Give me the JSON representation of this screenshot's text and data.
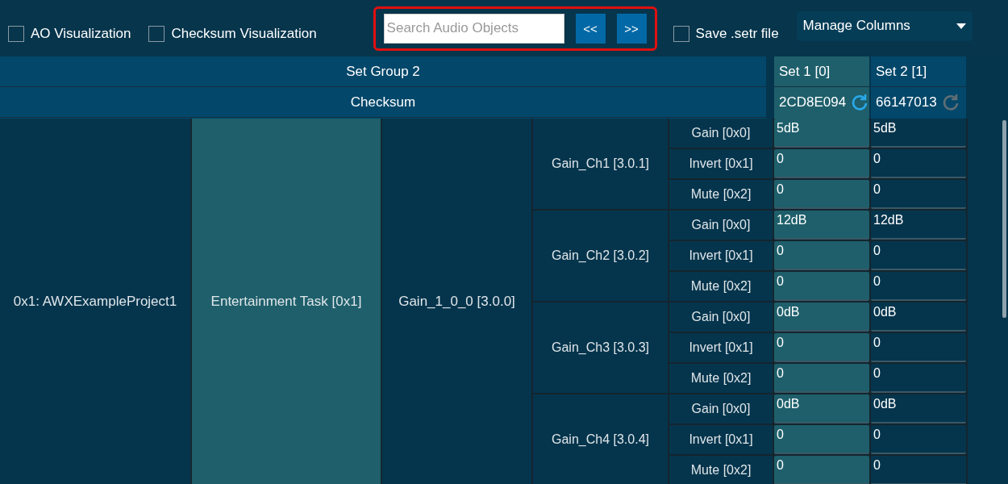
{
  "toolbar": {
    "checkboxes": [
      {
        "label": "AO Visualization",
        "checked": false
      },
      {
        "label": "Checksum Visualization",
        "checked": false
      }
    ],
    "search": {
      "placeholder": "Search Audio Objects",
      "highlighted": true,
      "buttons": [
        "<<",
        ">>"
      ]
    },
    "save_checkbox": {
      "label": "Save .setr file",
      "checked": false
    },
    "manage_columns": {
      "label": "Manage Columns"
    }
  },
  "header": {
    "group": "Set Group 2",
    "checksum_label": "Checksum",
    "sets": [
      {
        "name": "Set 1 [0]",
        "selected": true,
        "checksum": "2CD8E094",
        "refresh_enabled": true
      },
      {
        "name": "Set 2 [1]",
        "selected": false,
        "checksum": "66147013",
        "refresh_enabled": false
      }
    ]
  },
  "tree": {
    "project": "0x1: AWXExampleProject1",
    "task": "Entertainment Task [0x1]",
    "module": "Gain_1_0_0 [3.0.0]",
    "channels": [
      {
        "name": "Gain_Ch1 [3.0.1]",
        "params": [
          {
            "name": "Gain [0x0]",
            "values": [
              "5dB",
              "5dB"
            ]
          },
          {
            "name": "Invert [0x1]",
            "values": [
              "0",
              "0"
            ]
          },
          {
            "name": "Mute [0x2]",
            "values": [
              "0",
              "0"
            ]
          }
        ]
      },
      {
        "name": "Gain_Ch2 [3.0.2]",
        "params": [
          {
            "name": "Gain [0x0]",
            "values": [
              "12dB",
              "12dB"
            ]
          },
          {
            "name": "Invert [0x1]",
            "values": [
              "0",
              "0"
            ]
          },
          {
            "name": "Mute [0x2]",
            "values": [
              "0",
              "0"
            ]
          }
        ]
      },
      {
        "name": "Gain_Ch3 [3.0.3]",
        "params": [
          {
            "name": "Gain [0x0]",
            "values": [
              "0dB",
              "0dB"
            ]
          },
          {
            "name": "Invert [0x1]",
            "values": [
              "0",
              "0"
            ]
          },
          {
            "name": "Mute [0x2]",
            "values": [
              "0",
              "0"
            ]
          }
        ]
      },
      {
        "name": "Gain_Ch4 [3.0.4]",
        "params": [
          {
            "name": "Gain [0x0]",
            "values": [
              "0dB",
              "0dB"
            ]
          },
          {
            "name": "Invert [0x1]",
            "values": [
              "0",
              "0"
            ]
          },
          {
            "name": "Mute [0x2]",
            "values": [
              "0",
              "0"
            ]
          }
        ]
      }
    ]
  }
}
